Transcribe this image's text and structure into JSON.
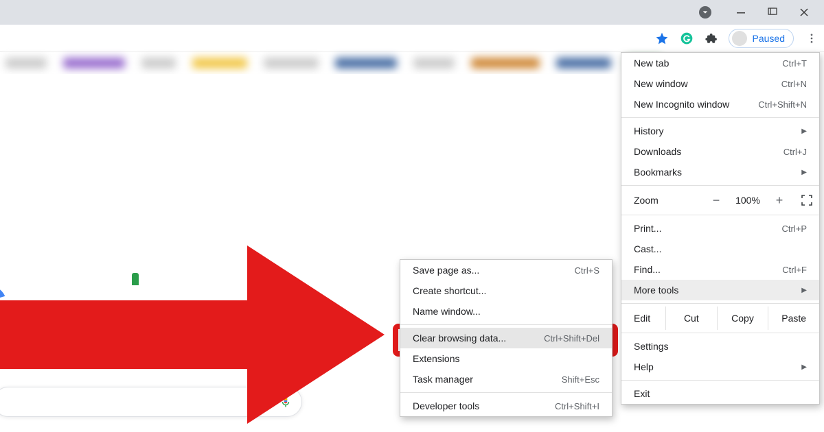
{
  "window": {
    "profile_status": "Paused"
  },
  "main_menu": {
    "items": [
      {
        "label": "New tab",
        "shortcut": "Ctrl+T"
      },
      {
        "label": "New window",
        "shortcut": "Ctrl+N"
      },
      {
        "label": "New Incognito window",
        "shortcut": "Ctrl+Shift+N"
      }
    ],
    "history": "History",
    "downloads": {
      "label": "Downloads",
      "shortcut": "Ctrl+J"
    },
    "bookmarks": "Bookmarks",
    "zoom_label": "Zoom",
    "zoom_value": "100%",
    "print": {
      "label": "Print...",
      "shortcut": "Ctrl+P"
    },
    "cast": "Cast...",
    "find": {
      "label": "Find...",
      "shortcut": "Ctrl+F"
    },
    "more_tools": "More tools",
    "edit": {
      "label": "Edit",
      "cut": "Cut",
      "copy": "Copy",
      "paste": "Paste"
    },
    "settings": "Settings",
    "help": "Help",
    "exit": "Exit"
  },
  "sub_menu": {
    "save_page": {
      "label": "Save page as...",
      "shortcut": "Ctrl+S"
    },
    "create_shortcut": "Create shortcut...",
    "name_window": "Name window...",
    "clear_data": {
      "label": "Clear browsing data...",
      "shortcut": "Ctrl+Shift+Del"
    },
    "extensions": "Extensions",
    "task_manager": {
      "label": "Task manager",
      "shortcut": "Shift+Esc"
    },
    "developer_tools": {
      "label": "Developer tools",
      "shortcut": "Ctrl+Shift+I"
    }
  }
}
